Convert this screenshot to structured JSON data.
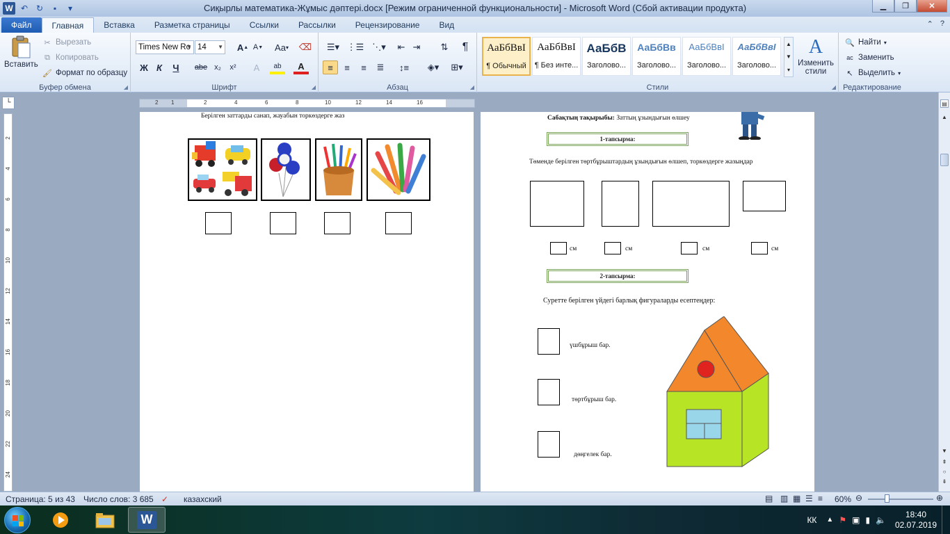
{
  "window": {
    "title": "Сиқырлы математика-Жұмыс дәптері.docx [Режим ограниченной функциональности] - Microsoft Word (Сбой активации продукта)"
  },
  "tabs": [
    "Файл",
    "Главная",
    "Вставка",
    "Разметка страницы",
    "Ссылки",
    "Рассылки",
    "Рецензирование",
    "Вид"
  ],
  "ribbon": {
    "clipboard": {
      "paste": "Вставить",
      "cut": "Вырезать",
      "copy": "Копировать",
      "format_painter": "Формат по образцу",
      "label": "Буфер обмена"
    },
    "font": {
      "name": "Times New Ro",
      "size": "14",
      "label": "Шрифт",
      "bold": "Ж",
      "italic": "К",
      "underline": "Ч",
      "strike": "abe",
      "sub": "x₂",
      "sup": "x²",
      "grow": "A",
      "shrink": "A",
      "case": "Aa"
    },
    "paragraph": {
      "label": "Абзац"
    },
    "styles": {
      "label": "Стили",
      "items": [
        {
          "sample": "АаБбВвI",
          "name": "¶ Обычный"
        },
        {
          "sample": "АаБбВвI",
          "name": "¶ Без инте..."
        },
        {
          "sample": "АаБбВ",
          "name": "Заголово..."
        },
        {
          "sample": "АаБбВв",
          "name": "Заголово..."
        },
        {
          "sample": "АаБбВвI",
          "name": "Заголово..."
        },
        {
          "sample": "АаБбВвІ",
          "name": "Заголово..."
        }
      ],
      "change": "Изменить стили"
    },
    "editing": {
      "label": "Редактирование",
      "find": "Найти",
      "replace": "Заменить",
      "select": "Выделить"
    }
  },
  "ruler": {
    "ticks": [
      "2",
      "1",
      "2",
      "4",
      "6",
      "8",
      "10",
      "12",
      "14",
      "16"
    ],
    "vticks": [
      "2",
      "4",
      "6",
      "8",
      "10",
      "12",
      "14",
      "16",
      "18",
      "20",
      "22",
      "24"
    ]
  },
  "document": {
    "left_page": {
      "instruction": "Берілген заттарды санап, жауабын торкөздерге жаз"
    },
    "right_page": {
      "topic_label": "Сабақтың тақырыбы:",
      "topic": "Заттың ұзындығын өлшеу",
      "task1": "1-тапсырма:",
      "task1_text": "Төменде берілген төртбұрыштардың ұзындығын өлшеп, торкөздерге жазыңдар",
      "unit": "см",
      "task2": "2-тапсырма:",
      "task2_text": "Суретте берілген үйдегі барлық фигураларды есептеңдер:",
      "triangles": "үшбұрыш бар.",
      "rectangles": "төртбұрыш бар.",
      "circles": "дөңгелек бар."
    }
  },
  "status": {
    "page": "Страница: 5 из 43",
    "words": "Число слов: 3 685",
    "lang": "казахский",
    "zoom": "60%"
  },
  "taskbar": {
    "lang": "КК",
    "time": "18:40",
    "date": "02.07.2019"
  }
}
